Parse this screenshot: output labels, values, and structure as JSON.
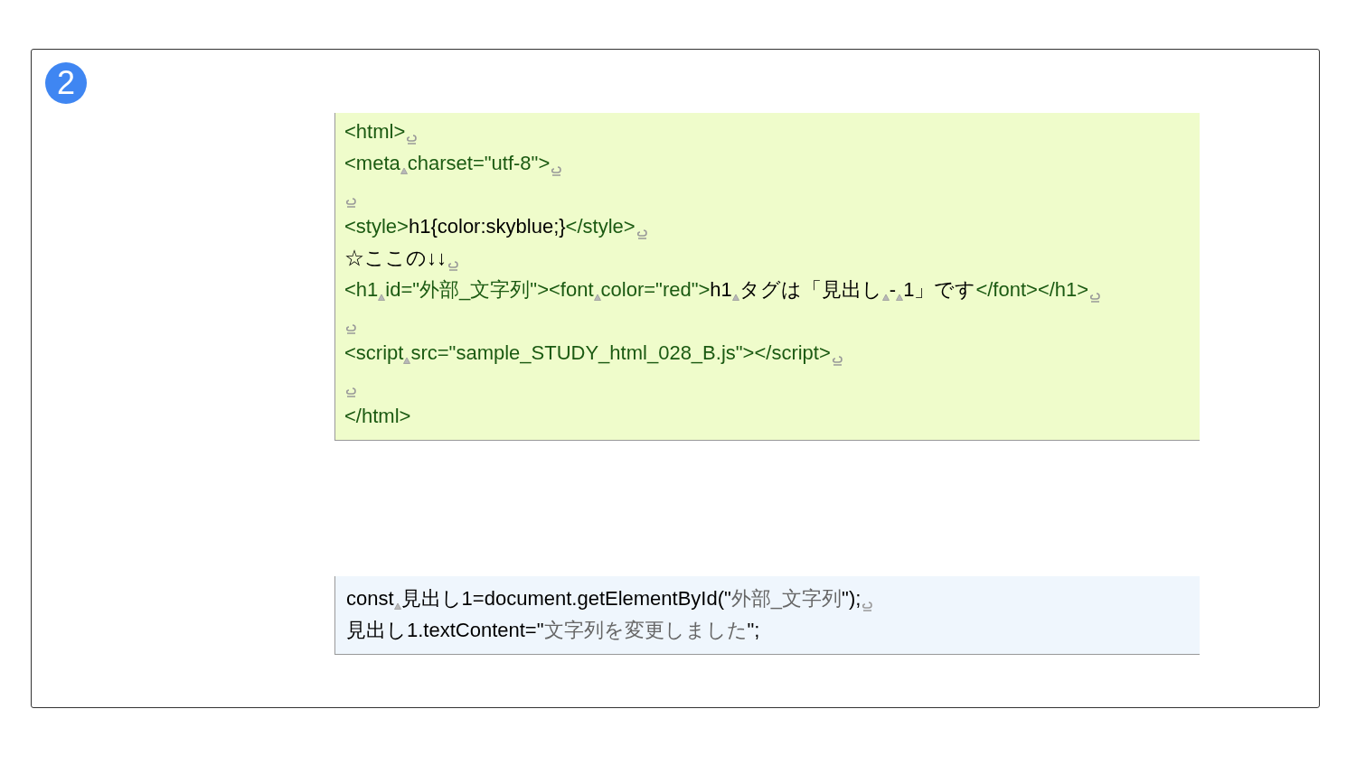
{
  "badge": "2",
  "code_blocks": [
    {
      "kind": "html",
      "lines": [
        {
          "runs": [
            [
              {
                "kind": "tag",
                "text": "<html>"
              }
            ]
          ],
          "return_mark": true
        },
        {
          "runs": [
            [
              {
                "kind": "tag",
                "text": "<meta"
              }
            ],
            [
              {
                "kind": "tag",
                "text": "charset=\"utf-8\">"
              }
            ]
          ],
          "return_mark": true
        },
        {
          "return_mark": true
        },
        {
          "runs": [
            [
              {
                "kind": "tag",
                "text": "<style>"
              },
              {
                "kind": "plain",
                "text": "h1{color:skyblue;}"
              },
              {
                "kind": "tag",
                "text": "</style>"
              }
            ]
          ],
          "return_mark": true
        },
        {
          "runs": [
            [
              {
                "kind": "plain",
                "text": "☆ここの↓↓"
              }
            ]
          ],
          "return_mark": true
        },
        {
          "runs": [
            [
              {
                "kind": "tag",
                "text": "<h1"
              }
            ],
            [
              {
                "kind": "tag",
                "text": "id=\"外部_文字列\"><font"
              }
            ],
            [
              {
                "kind": "tag",
                "text": "color=\"red\">"
              },
              {
                "kind": "plain",
                "text": "h1"
              }
            ],
            [
              {
                "kind": "plain",
                "text": "タグは「見出し"
              }
            ],
            [
              {
                "kind": "plain",
                "text": "-"
              }
            ],
            [
              {
                "kind": "plain",
                "text": "1」です"
              },
              {
                "kind": "tag",
                "text": "</font></h1>"
              }
            ]
          ],
          "return_mark": true
        },
        {
          "return_mark": true
        },
        {
          "runs": [
            [
              {
                "kind": "tag",
                "text": "<script"
              }
            ],
            [
              {
                "kind": "tag",
                "text": "src=\"sample_STUDY_html_028_B.js\"></script>"
              }
            ]
          ],
          "return_mark": true
        },
        {
          "return_mark": true
        },
        {
          "runs": [
            [
              {
                "kind": "tag",
                "text": "</html>"
              }
            ]
          ],
          "return_mark": false
        }
      ]
    },
    {
      "kind": "js",
      "lines": [
        {
          "runs": [
            [
              {
                "kind": "plain",
                "text": "const"
              }
            ],
            [
              {
                "kind": "plain",
                "text": "見出し1=document.getElementById(\""
              },
              {
                "kind": "string",
                "text": "外部_文字列"
              },
              {
                "kind": "plain",
                "text": "\");"
              }
            ]
          ],
          "return_mark": true
        },
        {
          "runs": [
            [
              {
                "kind": "plain",
                "text": "見出し1.textContent=\""
              },
              {
                "kind": "string",
                "text": "文字列を変更しました"
              },
              {
                "kind": "plain",
                "text": "\";"
              }
            ]
          ],
          "return_mark": false
        }
      ]
    }
  ]
}
